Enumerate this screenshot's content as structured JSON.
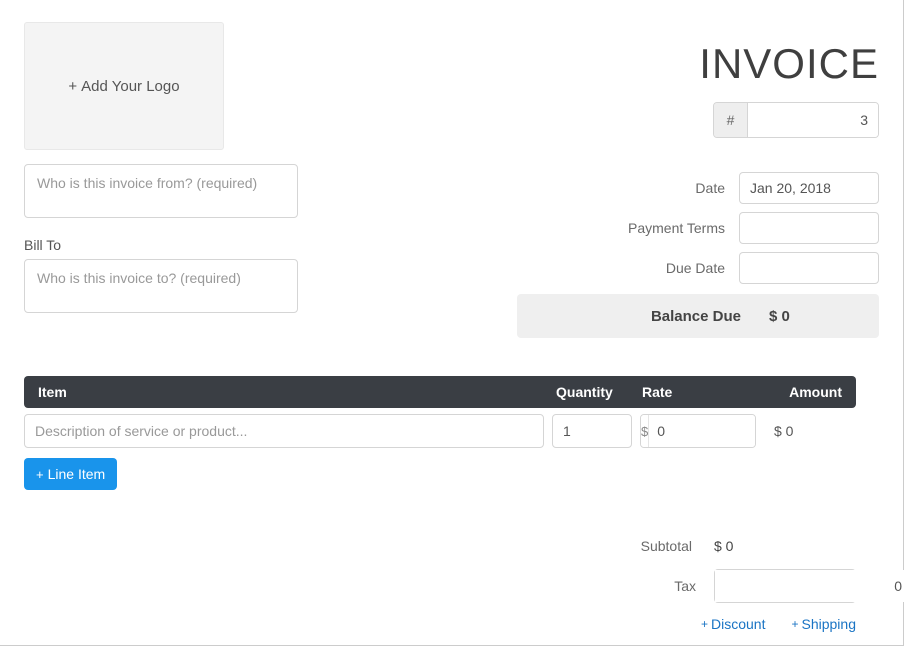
{
  "title": "INVOICE",
  "logo_label": "Add Your Logo",
  "number_prefix": "#",
  "number_value": "3",
  "from_placeholder": "Who is this invoice from? (required)",
  "billto_label": "Bill To",
  "billto_placeholder": "Who is this invoice to? (required)",
  "meta": {
    "date_label": "Date",
    "date_value": "Jan 20, 2018",
    "terms_label": "Payment Terms",
    "terms_value": "",
    "due_label": "Due Date",
    "due_value": "",
    "balance_label": "Balance Due",
    "balance_value": "$ 0"
  },
  "table": {
    "col_item": "Item",
    "col_qty": "Quantity",
    "col_rate": "Rate",
    "col_amount": "Amount",
    "row0": {
      "desc_placeholder": "Description of service or product...",
      "qty": "1",
      "rate_currency": "$",
      "rate": "0",
      "amount": "$ 0"
    }
  },
  "add_line_label": "Line Item",
  "totals": {
    "subtotal_label": "Subtotal",
    "subtotal_value": "$ 0",
    "tax_label": "Tax",
    "tax_value": "0",
    "tax_unit": "%"
  },
  "extras": {
    "discount_label": "Discount",
    "shipping_label": "Shipping"
  }
}
